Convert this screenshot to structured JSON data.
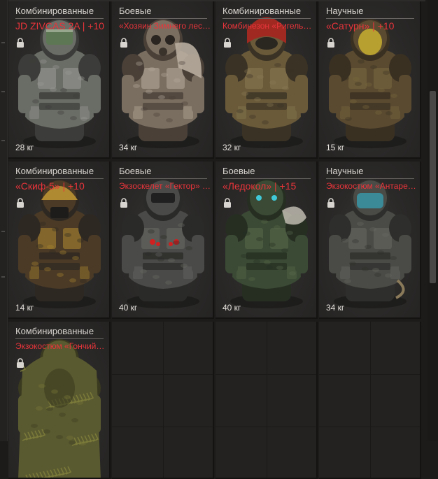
{
  "items": [
    {
      "category": "Комбинированные",
      "name": "JD ZIVCAS 2A | +10",
      "weight": "28 кг",
      "big": true,
      "palette": [
        "#6a6c66",
        "#9a9c98",
        "#3c3d3a",
        "#5a7a50"
      ]
    },
    {
      "category": "Боевые",
      "name": "«Хозяин Зимнего леса» | ...",
      "weight": "34 кг",
      "big": false,
      "palette": [
        "#7a6e60",
        "#b8ad9e",
        "#4a4038",
        "#5c524a"
      ]
    },
    {
      "category": "Комбинированные",
      "name": "Комбинезон «Ригель» | ...",
      "weight": "32 кг",
      "big": false,
      "palette": [
        "#6a5a3a",
        "#8a7a52",
        "#3a3224",
        "#a02a22"
      ]
    },
    {
      "category": "Научные",
      "name": "«Сатурн» | +10",
      "weight": "15 кг",
      "big": true,
      "palette": [
        "#5a4a30",
        "#7a6a40",
        "#3a3022",
        "#b8a030"
      ]
    },
    {
      "category": "Комбинированные",
      "name": "«Скиф-5» | +10",
      "weight": "14 кг",
      "big": true,
      "palette": [
        "#4a3a26",
        "#b08a30",
        "#2e2822",
        "#7a6030"
      ]
    },
    {
      "category": "Боевые",
      "name": "Экзоскелет «Гектор» | ...",
      "weight": "40 кг",
      "big": false,
      "palette": [
        "#4a4a48",
        "#6a6a66",
        "#2a2a28",
        "#d02020"
      ]
    },
    {
      "category": "Боевые",
      "name": "«Ледокол» | +15",
      "weight": "40 кг",
      "big": true,
      "palette": [
        "#3a4a34",
        "#5a6a4a",
        "#262e22",
        "#40c8d8"
      ]
    },
    {
      "category": "Научные",
      "name": "Экзокостюм «Антарес» ...",
      "weight": "34 кг",
      "big": false,
      "palette": [
        "#4a4a46",
        "#6a6a64",
        "#2e2e2c",
        "#3a8a98"
      ]
    },
    {
      "category": "Комбинированные",
      "name": "Экзокостюм «Гончий» | ...",
      "weight": "",
      "big": false,
      "palette": [
        "#5a5a30",
        "#7a7a3a",
        "#3a3a20",
        "#8a8a48"
      ]
    }
  ],
  "icons": {
    "lock": "lock-icon"
  }
}
